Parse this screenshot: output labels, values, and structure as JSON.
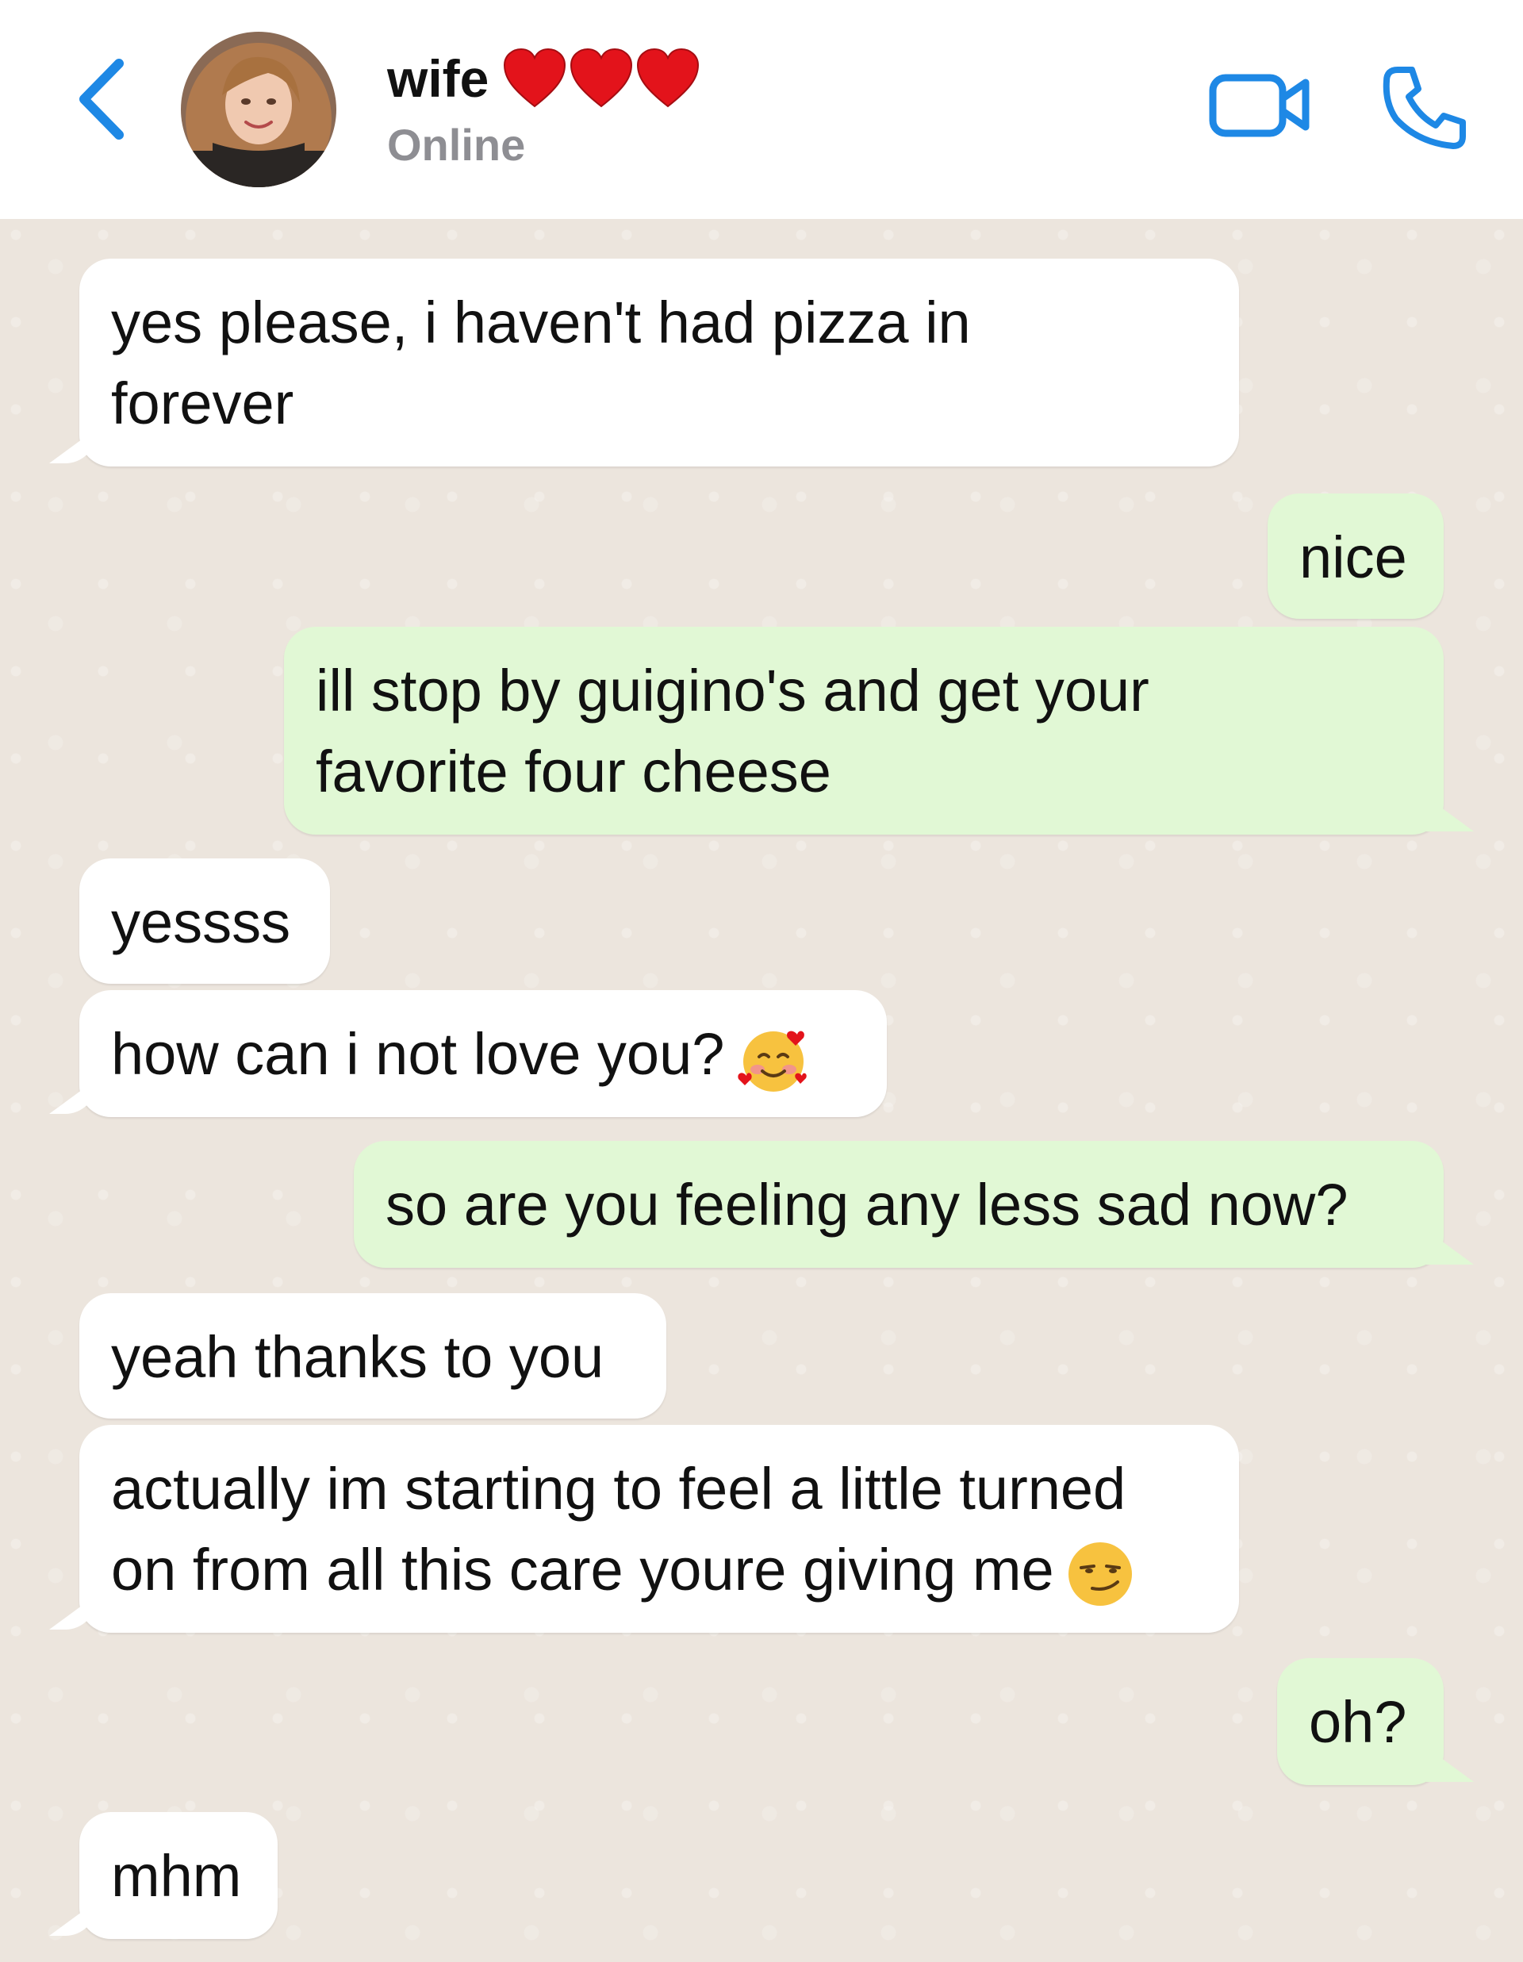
{
  "header": {
    "name": "wife",
    "status": "Online",
    "hearts": [
      "heart-icon",
      "heart-icon",
      "heart-icon"
    ],
    "back_icon": "chevron-left-icon",
    "video_icon": "video-camera-icon",
    "call_icon": "phone-icon"
  },
  "colors": {
    "accent": "#1e88e5",
    "incoming_bubble": "#ffffff",
    "outgoing_bubble": "#e1f8d5",
    "chat_background": "#ece5dd",
    "heart": "#e3131b"
  },
  "messages": [
    {
      "direction": "incoming",
      "line1": "yes please, i haven't had pizza in",
      "line2": "forever"
    },
    {
      "direction": "outgoing",
      "text": "nice"
    },
    {
      "direction": "outgoing",
      "line1": "ill stop by guigino's and get your",
      "line2": "favorite four cheese"
    },
    {
      "direction": "incoming",
      "text": "yessss"
    },
    {
      "direction": "incoming",
      "text": "how can i not love you?",
      "emoji": "smiling-face-with-hearts"
    },
    {
      "direction": "outgoing",
      "text": "so are you feeling any less sad now?"
    },
    {
      "direction": "incoming",
      "text": "yeah thanks to you"
    },
    {
      "direction": "incoming",
      "line1": "actually im starting to feel a little turned",
      "line2": "on from all this care youre giving me",
      "emoji": "smirking-face"
    },
    {
      "direction": "outgoing",
      "text": "oh?"
    },
    {
      "direction": "incoming",
      "text": "mhm"
    }
  ]
}
